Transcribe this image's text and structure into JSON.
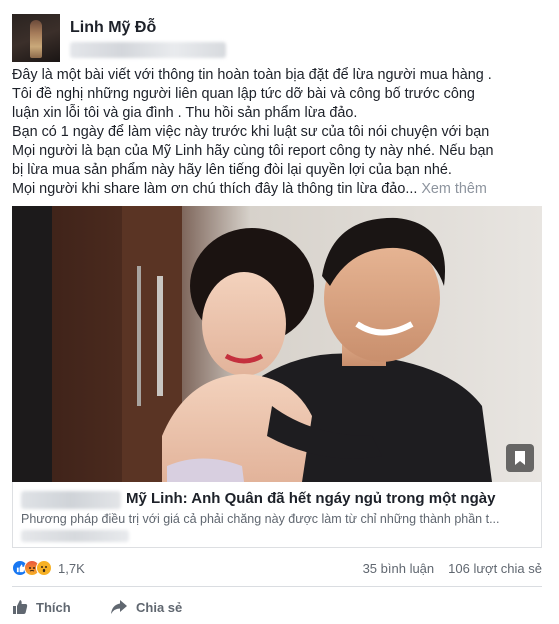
{
  "post": {
    "author": "Linh Mỹ Đỗ",
    "body_lines": [
      "Đây là một bài viết với thông tin hoàn toàn bịa đặt để lừa người mua hàng .",
      "Tôi đề nghị những người liên quan lập tức dỡ bài và công bố trước công",
      "luận xin lỗi tôi và gia đình . Thu hồi sản phẩm lừa đảo.",
      "Bạn có 1 ngày để làm việc này trước khi luật sư của tôi nói chuyện với bạn",
      "Mọi người là bạn của Mỹ Linh hãy cùng tôi report công ty này nhé. Nếu bạn",
      "bị lừa mua sản phẩm này hãy lên tiếng đòi lại quyền lợi của bạn nhé.",
      "Mọi người khi share làm ơn chú thích đây là thông tin lừa đảo..."
    ],
    "see_more": "Xem thêm"
  },
  "link_preview": {
    "title": "Mỹ Linh: Anh Quân đã hết ngáy ngủ trong một ngày",
    "description": "Phương pháp điều trị với giá cả phải chăng này được làm từ chỉ những thành phần t..."
  },
  "stats": {
    "reaction_count": "1,7K",
    "comments": "35 bình luận",
    "shares": "106 lượt chia sẻ"
  },
  "actions": {
    "like": "Thích",
    "share": "Chia sẻ"
  },
  "icons": {
    "like": "thumbs-up-icon",
    "share": "share-arrow-icon",
    "bookmark": "bookmark-icon",
    "reactions": [
      "like-reaction-icon",
      "angry-reaction-icon",
      "wow-reaction-icon"
    ]
  },
  "colors": {
    "text": "#1d2129",
    "muted": "#606770",
    "link_blue": "#1877f2",
    "divider": "#dadde1"
  }
}
